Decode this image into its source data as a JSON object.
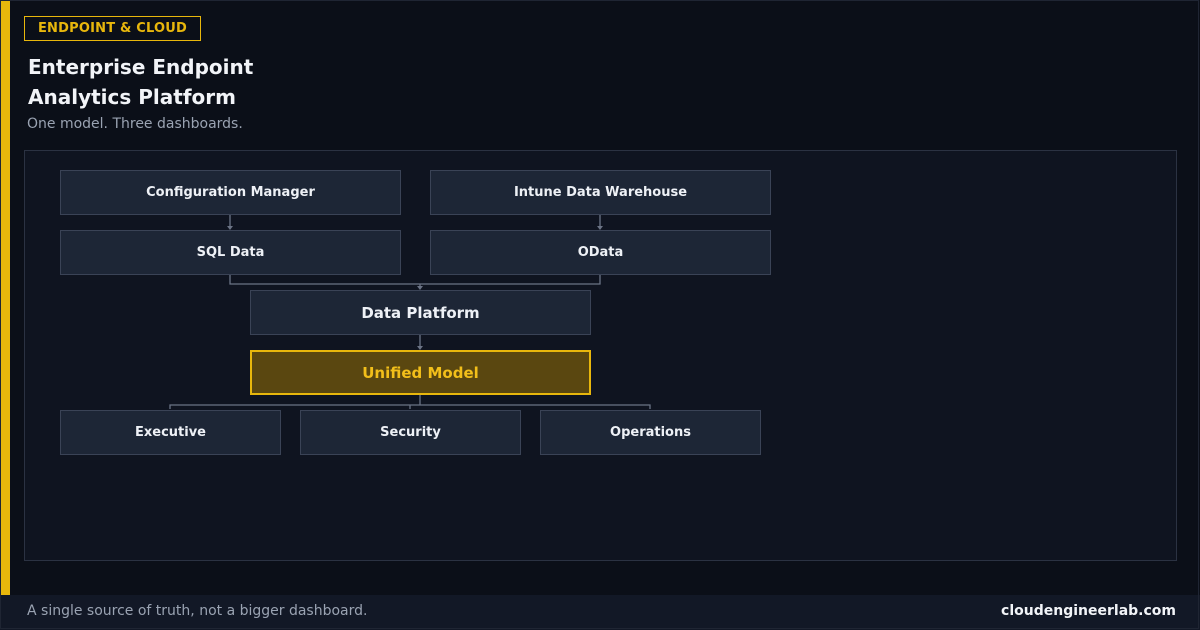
{
  "header": {
    "tag": "ENDPOINT & CLOUD",
    "title_line1": "Enterprise Endpoint",
    "title_line2": "Analytics Platform",
    "subtitle": "One model. Three dashboards."
  },
  "diagram": {
    "sources": {
      "left": "Configuration Manager",
      "right": "Intune Data Warehouse"
    },
    "feeds": {
      "left": "SQL Data",
      "right": "OData"
    },
    "platform": "Data Platform",
    "model": "Unified Model",
    "dashboards": [
      "Executive",
      "Security",
      "Operations"
    ]
  },
  "footer": {
    "tagline": "A single source of truth, not a bigger dashboard.",
    "site": "cloudengineerlab.com"
  },
  "colors": {
    "accent": "#e8b70c",
    "background": "#0b0f18",
    "node": "#1d2636",
    "model_fill": "#5a4710"
  }
}
